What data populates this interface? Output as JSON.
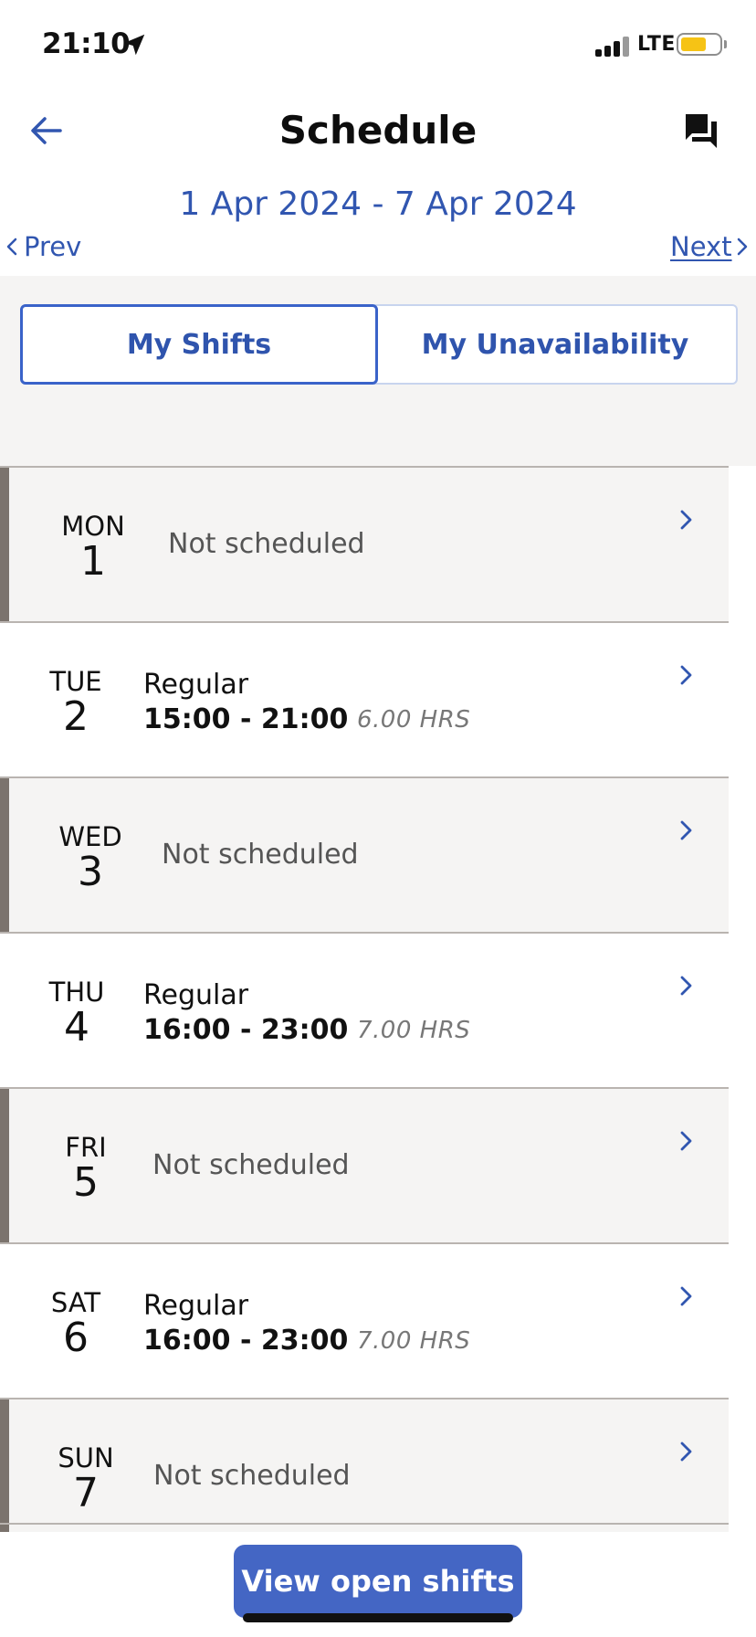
{
  "status": {
    "time": "21:10",
    "network": "LTE",
    "battery_color": "#f6c315"
  },
  "header": {
    "title": "Schedule",
    "back_icon": "arrow-left-icon",
    "chat_icon": "chat-bubbles-icon"
  },
  "week": {
    "range": "1 Apr 2024 - 7 Apr 2024",
    "prev_label": "Prev",
    "next_label": "Next"
  },
  "tabs": {
    "active": "My Shifts",
    "items": [
      {
        "label": "My Shifts"
      },
      {
        "label": "My Unavailability"
      }
    ]
  },
  "days": [
    {
      "dow": "MON",
      "num": "1",
      "status": "Not scheduled"
    },
    {
      "dow": "TUE",
      "num": "2",
      "type": "Regular",
      "time": "15:00 - 21:00",
      "hours": "6.00 HRS"
    },
    {
      "dow": "WED",
      "num": "3",
      "status": "Not scheduled"
    },
    {
      "dow": "THU",
      "num": "4",
      "type": "Regular",
      "time": "16:00 - 23:00",
      "hours": "7.00 HRS"
    },
    {
      "dow": "FRI",
      "num": "5",
      "status": "Not scheduled"
    },
    {
      "dow": "SAT",
      "num": "6",
      "type": "Regular",
      "time": "16:00 - 23:00",
      "hours": "7.00 HRS"
    },
    {
      "dow": "SUN",
      "num": "7",
      "status": "Not scheduled"
    }
  ],
  "footer": {
    "open_shifts_label": "View open shifts"
  },
  "colors": {
    "accent": "#3156b0",
    "button": "#4466c4",
    "row_grey": "#f5f4f3",
    "row_bar": "#7b736d"
  }
}
